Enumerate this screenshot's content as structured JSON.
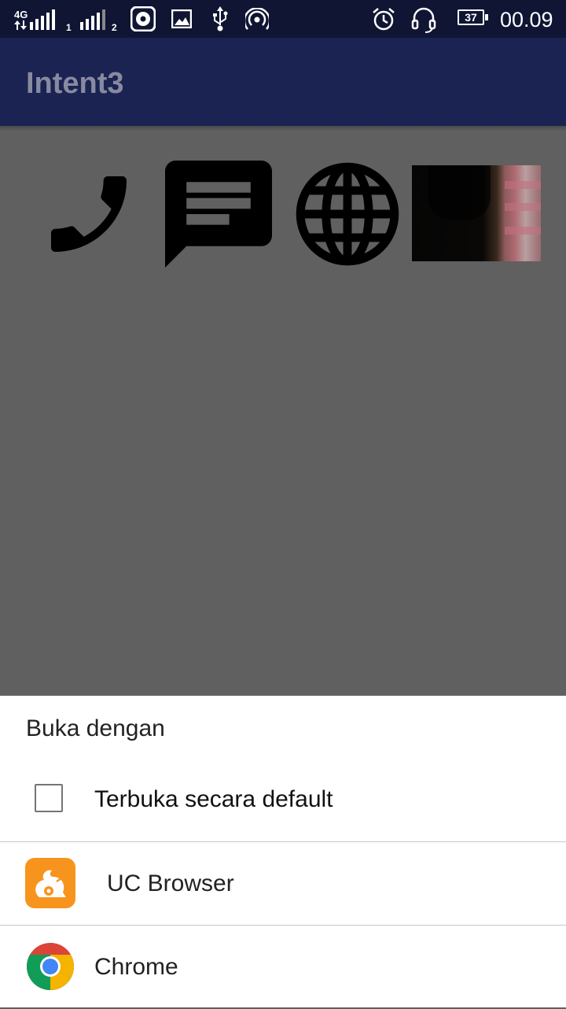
{
  "status_bar": {
    "network": "4G",
    "sim1": "1",
    "sim2": "2",
    "battery": "37",
    "time": "00.09"
  },
  "app": {
    "title": "Intent3"
  },
  "content": {
    "icons": [
      "phone-icon",
      "message-icon",
      "globe-icon",
      "photo-thumbnail"
    ]
  },
  "chooser": {
    "title": "Buka dengan",
    "default_label": "Terbuka secara default",
    "default_checked": false,
    "apps": [
      {
        "name": "UC Browser",
        "icon": "uc-browser-icon",
        "color": "#f7941d"
      },
      {
        "name": "Chrome",
        "icon": "chrome-icon"
      }
    ]
  },
  "colors": {
    "status_bar": "#0f1533",
    "app_bar": "#1a2352",
    "scrim": "#606060",
    "sheet": "#ffffff"
  }
}
